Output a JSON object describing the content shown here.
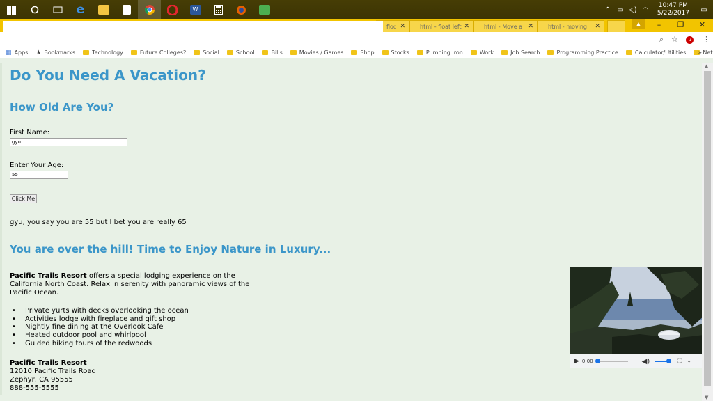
{
  "taskbar": {
    "apps": [
      "start",
      "cortana",
      "task-view",
      "edge",
      "file-explorer",
      "store",
      "chrome",
      "opera",
      "word",
      "calculator",
      "firefox",
      "notepad"
    ],
    "time": "10:47 PM",
    "date": "5/22/2017"
  },
  "browser": {
    "tabs": [
      {
        "label": "floc"
      },
      {
        "label": "html - float left"
      },
      {
        "label": "html - Move a"
      },
      {
        "label": "html - moving"
      }
    ],
    "bookmarks": [
      "Apps",
      "Bookmarks",
      "Technology",
      "Future Colleges?",
      "Social",
      "School",
      "Bills",
      "Movies / Games",
      "Shop",
      "Stocks",
      "Pumping Iron",
      "Work",
      "Job Search",
      "Programming Practice",
      "Calculator/Utilities",
      "Network testout"
    ],
    "more": "»"
  },
  "page": {
    "title": "Do You Need A Vacation?",
    "subtitle": "How Old Are You?",
    "first_name_label": "First Name:",
    "first_name_value": "gyu",
    "age_label": "Enter Your Age:",
    "age_value": "55",
    "button_label": "Click Me",
    "result": "gyu, you say you are 55 but I bet you are really 65",
    "headline": "You are over the hill! Time to Enjoy Nature in Luxury...",
    "intro_bold": "Pacific Trails Resort",
    "intro_rest": " offers a special lodging experience on the California North Coast. Relax in serenity with panoramic views of the Pacific Ocean.",
    "features": [
      "Private yurts with decks overlooking the ocean",
      "Activities lodge with fireplace and gift shop",
      "Nightly fine dining at the Overlook Cafe",
      "Heated outdoor pool and whirlpool",
      "Guided hiking tours of the redwoods"
    ],
    "address": {
      "name": "Pacific Trails Resort",
      "street": "12010 Pacific Trails Road",
      "city": "Zephyr, CA 95555",
      "phone": "888-555-5555"
    }
  },
  "video": {
    "time": "0:00",
    "progress": 0,
    "volume": 0.75
  }
}
